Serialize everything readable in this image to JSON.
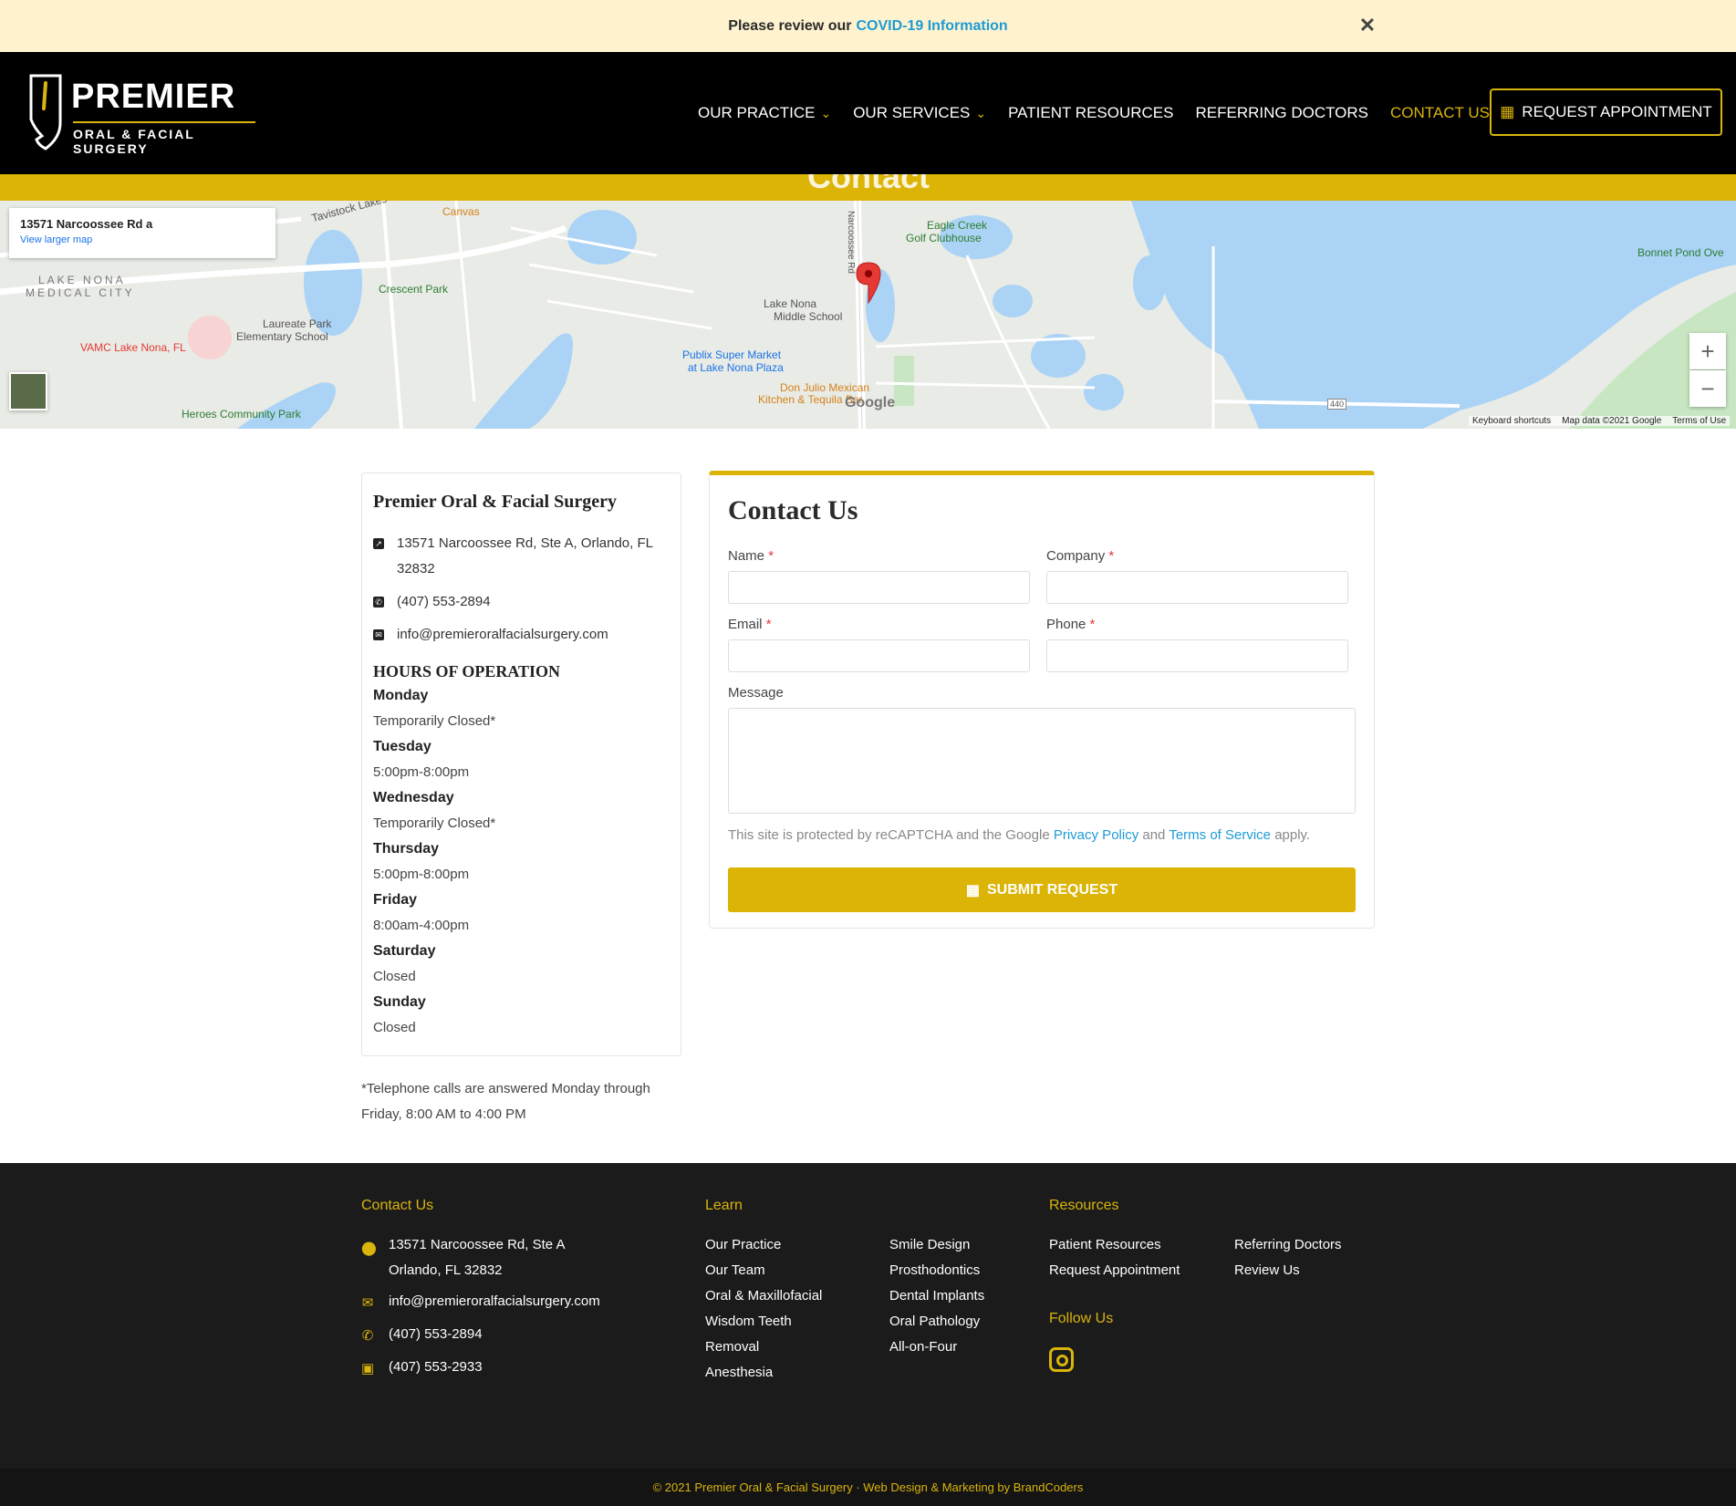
{
  "notice": {
    "prefix": "Please review our",
    "link": "COVID-19 Information",
    "close": "✕"
  },
  "header": {
    "logo_name": "PREMIER",
    "logo_sub": "ORAL & FACIAL SURGERY",
    "nav": [
      {
        "label": "OUR PRACTICE",
        "dropdown": true
      },
      {
        "label": "OUR SERVICES",
        "dropdown": true
      },
      {
        "label": "PATIENT RESOURCES",
        "dropdown": false
      },
      {
        "label": "REFERRING DOCTORS",
        "dropdown": false
      },
      {
        "label": "CONTACT US",
        "dropdown": false,
        "active": true
      }
    ],
    "request_button": "REQUEST APPOINTMENT",
    "accent_color": "#d9b40c"
  },
  "banner": {
    "title": "Contact"
  },
  "map": {
    "address": "13571 Narcoossee Rd a",
    "larger_map": "View larger map",
    "zoom_in": "+",
    "zoom_out": "−",
    "keyboard": "Keyboard shortcuts",
    "map_data": "Map data ©2021 Google",
    "terms": "Terms of Use",
    "google": "Google",
    "labels": {
      "canvas": "Canvas",
      "eagle_creek": "Eagle Creek",
      "golf": "Golf Clubhouse",
      "lake_nona_med": "LAKE NONA",
      "medical_city": "MEDICAL CITY",
      "crescent_park": "Crescent Park",
      "laureate_park": "Laureate Park",
      "elementary": "Elementary School",
      "vamc": "VAMC Lake Nona, FL",
      "lake_nona_ms": "Lake Nona",
      "middle_school": "Middle School",
      "publix": "Publix Super Market",
      "publix2": "at Lake Nona Plaza",
      "don_julio": "Don Julio Mexican",
      "kitchen": "Kitchen & Tequila Bar",
      "heroes": "Heroes Community Park",
      "bonnet": "Bonnet Pond Ove",
      "narcoossee": "Narcoossee Rd",
      "tavistock": "Tavistock Lakes Blvd",
      "route": "440"
    }
  },
  "info_card": {
    "title": "Premier Oral & Facial Surgery",
    "address": "13571 Narcoossee Rd, Ste A, Orlando, FL 32832",
    "phone": "(407) 553-2894",
    "email": "info@premieroralfacialsurgery.com",
    "hours_title": "HOURS OF OPERATION",
    "hours": [
      {
        "day": "Monday",
        "time": "Temporarily Closed*"
      },
      {
        "day": "Tuesday",
        "time": "5:00pm-8:00pm"
      },
      {
        "day": "Wednesday",
        "time": "Temporarily Closed*"
      },
      {
        "day": "Thursday",
        "time": "5:00pm-8:00pm"
      },
      {
        "day": "Friday",
        "time": "8:00am-4:00pm"
      },
      {
        "day": "Saturday",
        "time": "Closed"
      },
      {
        "day": "Sunday",
        "time": "Closed"
      }
    ],
    "note": "*Telephone calls are answered Monday through Friday, 8:00 AM to 4:00 PM"
  },
  "form": {
    "title": "Contact Us",
    "name_label": "Name",
    "company_label": "Company",
    "email_label": "Email",
    "phone_label": "Phone",
    "message_label": "Message",
    "required_mark": "*",
    "captcha_prefix": "This site is protected by reCAPTCHA and the Google",
    "privacy": "Privacy Policy",
    "and": "and",
    "terms": "Terms of Service",
    "apply": "apply.",
    "submit": "SUBMIT REQUEST"
  },
  "footer": {
    "contact_title": "Contact Us",
    "address_line1": "13571 Narcoossee Rd, Ste A",
    "address_line2": "Orlando, FL 32832",
    "email": "info@premieroralfacialsurgery.com",
    "phone": "(407) 553-2894",
    "fax": "(407) 553-2933",
    "learn_title": "Learn",
    "learn_col1": [
      "Our Practice",
      "Our Team",
      "Oral & Maxillofacial",
      "Wisdom Teeth",
      "Removal",
      "Anesthesia"
    ],
    "learn_col2": [
      "Smile Design",
      "Prosthodontics",
      "Dental Implants",
      "Oral Pathology",
      "All-on-Four"
    ],
    "resources_title": "Resources",
    "resources_col1": [
      "Patient Resources",
      "Request Appointment"
    ],
    "resources_col2": [
      "Referring Doctors",
      "Review Us"
    ],
    "follow_title": "Follow Us",
    "copyright": "© 2021 Premier Oral & Facial Surgery · Web Design & Marketing by BrandCoders"
  }
}
